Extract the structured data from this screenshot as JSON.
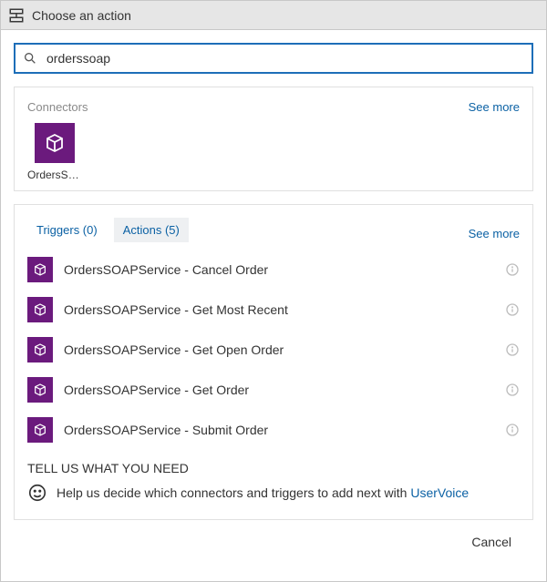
{
  "header": {
    "title": "Choose an action"
  },
  "search": {
    "value": "orderssoap"
  },
  "connectors": {
    "heading": "Connectors",
    "see_more": "See more",
    "items": [
      {
        "label": "OrdersSOA..."
      }
    ]
  },
  "tabs": {
    "triggers": "Triggers (0)",
    "actions": "Actions (5)",
    "see_more": "See more"
  },
  "actions": [
    {
      "label": "OrdersSOAPService - Cancel Order"
    },
    {
      "label": "OrdersSOAPService - Get Most Recent"
    },
    {
      "label": "OrdersSOAPService - Get Open Order"
    },
    {
      "label": "OrdersSOAPService - Get Order"
    },
    {
      "label": "OrdersSOAPService - Submit Order"
    }
  ],
  "feedback": {
    "heading": "TELL US WHAT YOU NEED",
    "text_pre": "Help us decide which connectors and triggers to add next with ",
    "link": "UserVoice"
  },
  "footer": {
    "cancel": "Cancel"
  }
}
